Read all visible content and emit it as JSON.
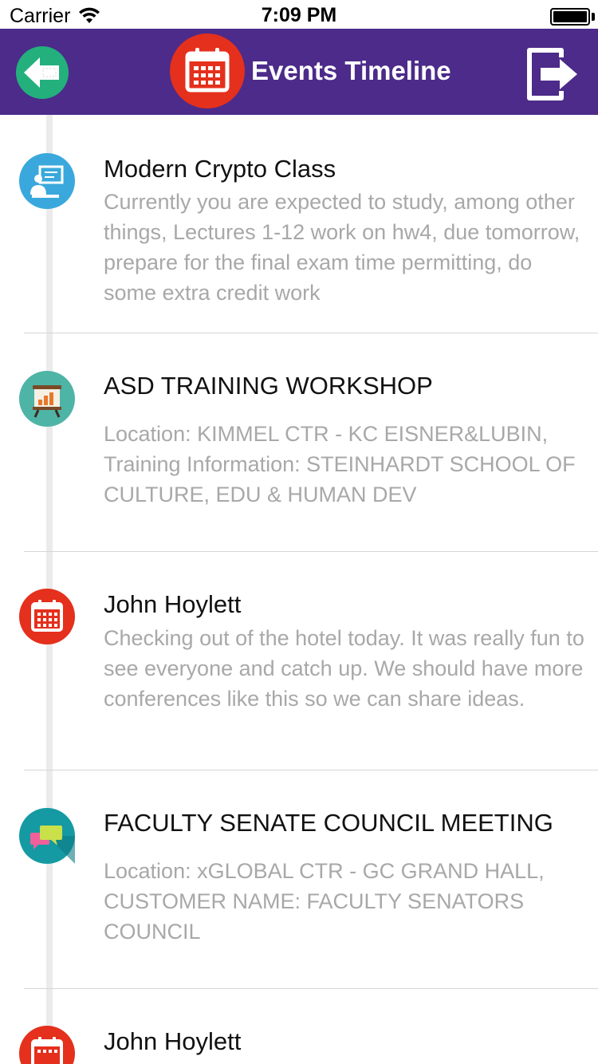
{
  "status_bar": {
    "carrier": "Carrier",
    "time": "7:09 PM",
    "wifi_icon": "wifi-icon",
    "battery_icon": "battery-icon"
  },
  "nav": {
    "title": "Events Timeline",
    "back_icon": "back-arrow-icon",
    "logo_icon": "calendar-icon",
    "exit_icon": "logout-icon",
    "background_color": "#4c2b8a"
  },
  "events": [
    {
      "title": "Modern Crypto Class",
      "description": "Currently you are expected to study, among other things, Lectures 1-12 work on hw4, due tomorrow, prepare for the final exam time permitting, do some extra credit work",
      "icon": "lecture-icon",
      "icon_color": "#3aa8dc"
    },
    {
      "title": "ASD TRAINING WORKSHOP",
      "description": "Location: KIMMEL CTR - KC EISNER&LUBIN, Training Information: STEINHARDT SCHOOL OF CULTURE, EDU & HUMAN DEV",
      "icon": "presentation-board-icon",
      "icon_color": "#4eb4a6"
    },
    {
      "title": "John Hoylett",
      "description": "Checking out of the hotel today. It was really fun to see everyone and catch up. We should have more conferences like this so we can share ideas.",
      "icon": "calendar-icon",
      "icon_color": "#e4301c"
    },
    {
      "title": "FACULTY SENATE COUNCIL MEETING",
      "description": "Location: xGLOBAL CTR - GC GRAND HALL, CUSTOMER NAME: FACULTY SENATORS COUNCIL",
      "icon": "chat-bubbles-icon",
      "icon_color": "#159aa3"
    },
    {
      "title": "John Hoylett",
      "description": "",
      "icon": "calendar-icon",
      "icon_color": "#e4301c"
    }
  ]
}
